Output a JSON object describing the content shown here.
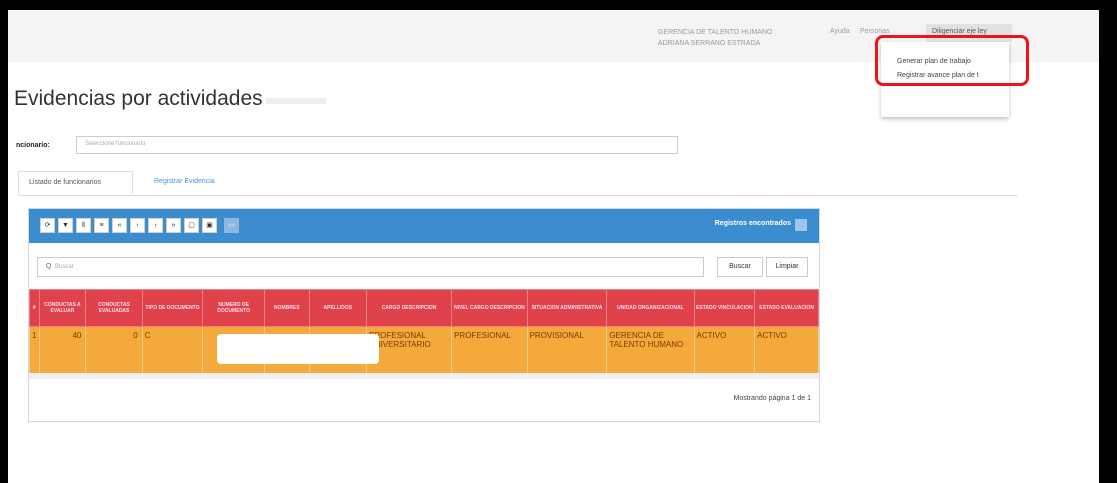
{
  "topbar": {
    "unit": "GERENCIA DE TALENTO HUMANO",
    "user": "ADRIANA SERRANO ESTRADA",
    "nav_help": "Ayuda",
    "nav_personal": "Personas",
    "nav_active": "Diligenciar eje ley"
  },
  "dropdown": {
    "items": [
      "Generar plan de trabajo",
      "Registrar avance plan de t"
    ]
  },
  "page": {
    "title": "Evidencias por actividades",
    "funcionario_label": "ncionario:",
    "funcionario_placeholder": "Seleccione funcionario"
  },
  "tabs": [
    "Listado de funcionarios",
    "Registrar Evidencia"
  ],
  "toolbar": {
    "icons": [
      "refresh-icon",
      "filter-icon",
      "columns-icon",
      "list-icon",
      "first-page-icon",
      "prev-page-icon",
      "next-page-icon",
      "last-page-icon",
      "copy-icon",
      "export-icon",
      "image-icon"
    ],
    "glyphs": [
      "⟳",
      "▼",
      "⦀",
      "≡",
      "«",
      "‹",
      "›",
      "»",
      "▢",
      "▣",
      "▭"
    ],
    "records_label": "Registros encontrados"
  },
  "search": {
    "placeholder": "Buscar",
    "search_btn": "Buscar",
    "clear_btn": "Limpiar"
  },
  "table": {
    "headers": [
      "#",
      "CONDUCTAS A EVALUAR",
      "CONDUCTAS EVALUADAS",
      "TIPO DE DOCUMENTO",
      "NUMERO DE DOCUMENTO",
      "NOMBRES",
      "APELLIDOS",
      "CARGO DESCRIPCION",
      "NIVEL CARGO DESCRIPCION",
      "SITUACION ADMINISTRATIVA",
      "UNIDAD ORGANIZACIONAL",
      "ESTADO VINCULACION",
      "ESTADO EVALUACION"
    ],
    "rows": [
      [
        "1",
        "40",
        "0",
        "C",
        "",
        "",
        "",
        "PROFESIONAL UNIVERSITARIO",
        "PROFESIONAL",
        "PROVISIONAL",
        "GERENCIA DE TALENTO HUMANO",
        "ACTIVO",
        "ACTIVO"
      ]
    ]
  },
  "pagination": {
    "text": "Mostrando página 1 de 1"
  },
  "colors": {
    "header_blue": "#3c8dcf",
    "table_header_red": "#e0424c",
    "row_orange": "#f5a93a",
    "highlight_red": "#e8161b"
  }
}
